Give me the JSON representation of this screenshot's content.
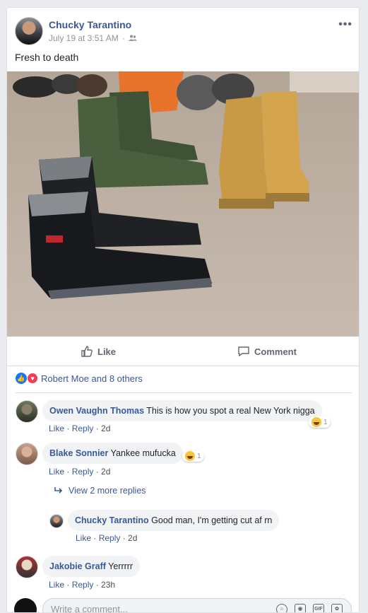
{
  "post": {
    "author": "Chucky Tarantino",
    "timestamp": "July 19 at 3:51 AM",
    "audience_icon": "friends-icon",
    "text": "Fresh to death",
    "more_label": "•••"
  },
  "actions": {
    "like_label": "Like",
    "comment_label": "Comment"
  },
  "reactions": {
    "summary": "Robert Moe and 8 others"
  },
  "comments": [
    {
      "author": "Owen Vaughn Thomas",
      "text": "This is how you spot a real New York nigga",
      "like": "Like",
      "reply": "Reply",
      "age": "2d",
      "reaction_count": "1"
    },
    {
      "author": "Blake Sonnier",
      "text": "Yankee mufucka",
      "like": "Like",
      "reply": "Reply",
      "age": "2d",
      "reaction_count": "1"
    },
    {
      "author": "Chucky Tarantino",
      "text": "Good man, I'm getting cut af rn",
      "like": "Like",
      "reply": "Reply",
      "age": "2d"
    },
    {
      "author": "Jakobie Graff",
      "text": "Yerrrrr",
      "like": "Like",
      "reply": "Reply",
      "age": "23h"
    }
  ],
  "view_more_replies": "View 2 more replies",
  "composer": {
    "placeholder": "Write a comment...",
    "icons": [
      "emoji-icon",
      "camera-icon",
      "gif-icon",
      "sticker-icon"
    ],
    "gif_label": "GIF"
  },
  "colors": {
    "link": "#385898",
    "bubble": "#f2f3f5",
    "page_bg": "#e9ebee"
  }
}
